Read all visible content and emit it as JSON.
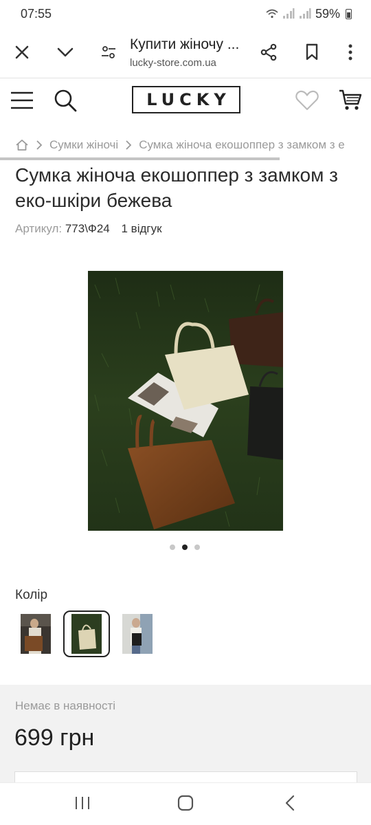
{
  "status_bar": {
    "time": "07:55",
    "battery": "59%"
  },
  "browser": {
    "title": "Купити жіночу ...",
    "url": "lucky-store.com.ua",
    "icons": [
      "close-icon",
      "chevron-down-icon",
      "page-settings-icon",
      "share-icon",
      "bookmark-icon",
      "more-vert-icon"
    ]
  },
  "site": {
    "logo_text": "LUCKY",
    "icons": [
      "menu-icon",
      "search-icon",
      "heart-icon",
      "cart-icon"
    ]
  },
  "breadcrumb": {
    "items": [
      "Сумки жіночі",
      "Сумка жіноча екошоппер з замком з е"
    ]
  },
  "product": {
    "title": "Сумка жіноча екошоппер з замком з еко-шкіри бежева",
    "sku_label": "Артикул:",
    "sku": "773\\Ф24",
    "reviews": "1 відгук"
  },
  "gallery": {
    "total": 3,
    "active_index": 1
  },
  "color": {
    "label": "Колір",
    "swatches": [
      "brown",
      "beige",
      "black"
    ],
    "selected_index": 1
  },
  "purchase": {
    "stock_status": "Немає в наявності",
    "price": "699 грн"
  },
  "nav": {
    "icons": [
      "recent-apps-icon",
      "home-icon",
      "back-icon"
    ]
  },
  "colors": {
    "accent": "#222222",
    "muted_text": "#9a9a9a",
    "price_bg": "#f2f2f2"
  }
}
